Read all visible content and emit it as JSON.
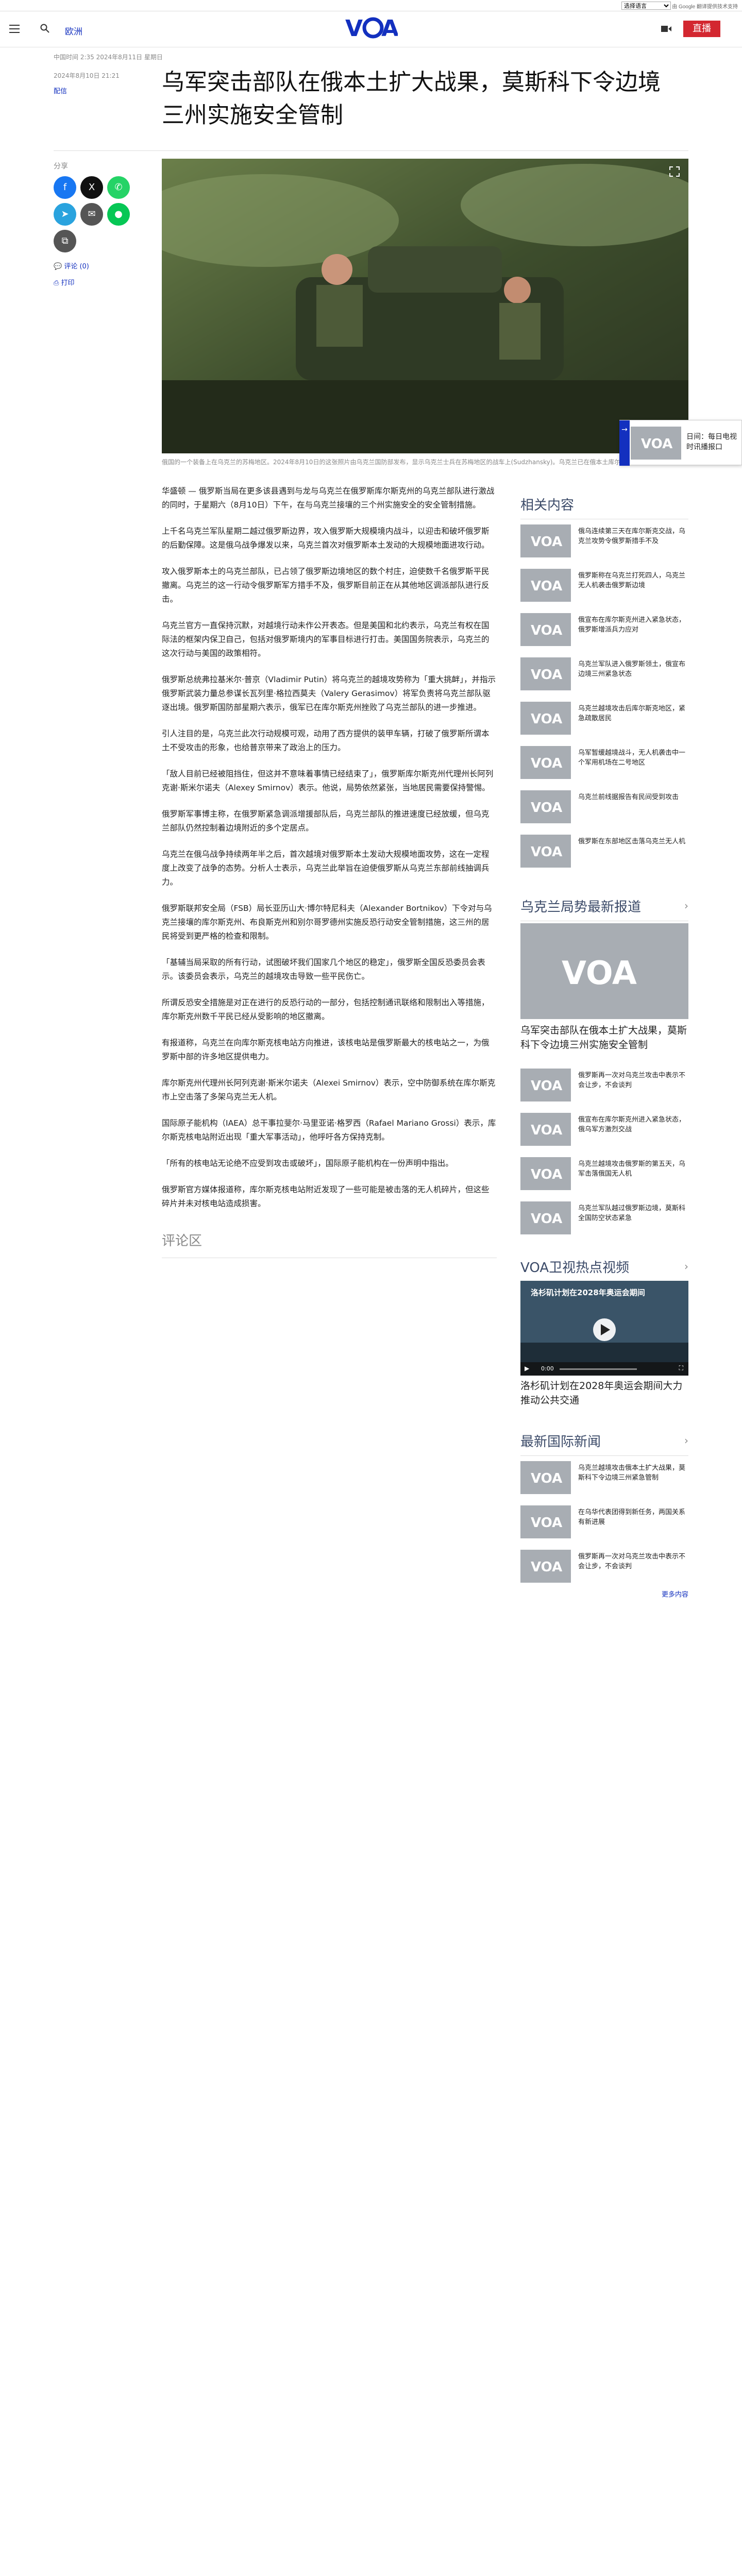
{
  "translate": {
    "select_value": "选择语言",
    "powered_by": "由 Google 翻译提供技术支持"
  },
  "header": {
    "region": "欧洲",
    "live_label": "直播"
  },
  "article": {
    "dateline": "中国时间 2:35 2024年8月11日 星期日",
    "date": "2024年8月10日 21:21",
    "author": "配信",
    "title": "乌军突击部队在俄本土扩大战果，莫斯科下令边境三州实施安全管制",
    "share_label": "分享",
    "comments_link": "评论 (0)",
    "print_link": "打印",
    "caption": "俄国的一个装备上在乌克兰的苏梅地区。2024年8月10日的这张照片由乌克兰国防部发布，显示乌克兰士兵在苏梅地区的战车上(Sudzhansky)。乌克兰已在俄本土库尔斯克州发起越境攻势。",
    "paragraphs": [
      "华盛顿 — 俄罗斯当局在更多该县遇到与龙与乌克兰在俄罗斯库尔斯克州的乌克兰部队进行激战的同时，于星期六（8月10日）下午，在与乌克兰接壤的三个州实施安全的安全管制措施。",
      "上千名乌克兰军队星期二越过俄罗斯边界，攻入俄罗斯大规模境内战斗，以迎击和破坏俄罗斯的后勤保障。这是俄乌战争爆发以来，乌克兰首次对俄罗斯本土发动的大规模地面进攻行动。",
      "攻入俄罗斯本土的乌克兰部队，已占领了俄罗斯边境地区的数个村庄，迫使数千名俄罗斯平民撤离。乌克兰的这一行动令俄罗斯军方措手不及，俄罗斯目前正在从其他地区调派部队进行反击。",
      "乌克兰官方一直保持沉默，对越境行动未作公开表态。但是美国和北约表示，乌克兰有权在国际法的框架内保卫自己，包括对俄罗斯境内的军事目标进行打击。美国国务院表示，乌克兰的这次行动与美国的政策相符。",
      "俄罗斯总统弗拉基米尔·普京（Vladimir Putin）将乌克兰的越境攻势称为「重大挑衅」，并指示俄罗斯武装力量总参谋长瓦列里·格拉西莫夫（Valery Gerasimov）将军负责将乌克兰部队驱逐出境。俄罗斯国防部星期六表示，俄军已在库尔斯克州挫败了乌克兰部队的进一步推进。",
      "引人注目的是，乌克兰此次行动规模可观，动用了西方提供的装甲车辆，打破了俄罗斯所谓本土不受攻击的形象，也给普京带来了政治上的压力。",
      "「敌人目前已经被阻挡住，但这并不意味着事情已经结束了」，俄罗斯库尔斯克州代理州长阿列克谢·斯米尔诺夫（Alexey Smirnov）表示。他说，局势依然紧张，当地居民需要保持警惕。",
      "俄罗斯军事博主称，在俄罗斯紧急调派增援部队后，乌克兰部队的推进速度已经放缓，但乌克兰部队仍然控制着边境附近的多个定居点。",
      "乌克兰在俄乌战争持续两年半之后，首次越境对俄罗斯本土发动大规模地面攻势，这在一定程度上改变了战争的态势。分析人士表示，乌克兰此举旨在迫使俄罗斯从乌克兰东部前线抽调兵力。",
      "俄罗斯联邦安全局（FSB）局长亚历山大·博尔特尼科夫（Alexander Bortnikov）下令对与乌克兰接壤的库尔斯克州、布良斯克州和别尔哥罗德州实施反恐行动安全管制措施，这三州的居民将受到更严格的检查和限制。",
      "「基辅当局采取的所有行动，试图破坏我们国家几个地区的稳定」，俄罗斯全国反恐委员会表示。该委员会表示，乌克兰的越境攻击导致一些平民伤亡。",
      "所谓反恐安全措施是对正在进行的反恐行动的一部分，包括控制通讯联络和限制出入等措施，库尔斯克州数千平民已经从受影响的地区撤离。",
      "有报道称，乌克兰在向库尔斯克核电站方向推进，该核电站是俄罗斯最大的核电站之一，为俄罗斯中部的许多地区提供电力。",
      "库尔斯克州代理州长阿列克谢·斯米尔诺夫（Alexei Smirnov）表示，空中防御系统在库尔斯克市上空击落了多架乌克兰无人机。",
      "国际原子能机构（IAEA）总干事拉斐尔·马里亚诺·格罗西（Rafael Mariano Grossi）表示，库尔斯克核电站附近出现「重大军事活动」，他呼吁各方保持克制。",
      "「所有的核电站无论绝不应受到攻击或破坏」，国际原子能机构在一份声明中指出。",
      "俄罗斯官方媒体报道称，库尔斯克核电站附近发现了一些可能是被击落的无人机碎片，但这些碎片并未对核电站造成损害。"
    ],
    "comments_heading": "评论区"
  },
  "float": {
    "label": "日间：每日电视时讯播报口"
  },
  "sidebar": {
    "related_heading": "相关内容",
    "related": [
      "俄乌连续第三天在库尔斯克交战，乌克兰攻势令俄罗斯措手不及",
      "俄罗斯称在乌克兰打死四人，乌克兰无人机袭击俄罗斯边境",
      "俄宣布在库尔斯克州进入紧急状态，俄罗斯增派兵力应对",
      "乌克兰军队进入俄罗斯领土，俄宣布边境三州紧急状态",
      "乌克兰越境攻击后库尔斯克地区，紧急疏散居民",
      "乌军暂缓越境战斗，无人机袭击中一个军用机场在二号地区",
      "乌克兰前线据报告有民间受到攻击",
      "俄罗斯在东部地区击落乌克兰无人机"
    ],
    "border_heading": "乌克兰局势最新报道",
    "border_big_title": "乌军突击部队在俄本土扩大战果，莫斯科下令边境三州实施安全管制",
    "border_items": [
      "俄罗斯再一次对乌克兰攻击中表示不会让步，不会谈判",
      "俄宣布在库尔斯克州进入紧急状态，俄乌军方激烈交战",
      "乌克兰越境攻击俄罗斯的第五天，乌军击落俄国无人机",
      "乌克兰军队越过俄罗斯边境，莫斯科全国防空状态紧急"
    ],
    "video_heading": "VOA卫视热点视频",
    "video_overlay_title": "洛杉矶计划在2028年奥运会期间",
    "video_time": "0:00",
    "video_title": "洛杉矶计划在2028年奥运会期间大力推动公共交通",
    "intl_heading": "最新国际新闻",
    "intl_items": [
      "乌克兰越境攻击俄本土扩大战果，莫斯科下令边境三州紧急管制",
      "在乌华代表团得到新任务，两国关系有新进展",
      "俄罗斯再一次对乌克兰攻击中表示不会让步，不会谈判"
    ],
    "more": "更多内容"
  }
}
